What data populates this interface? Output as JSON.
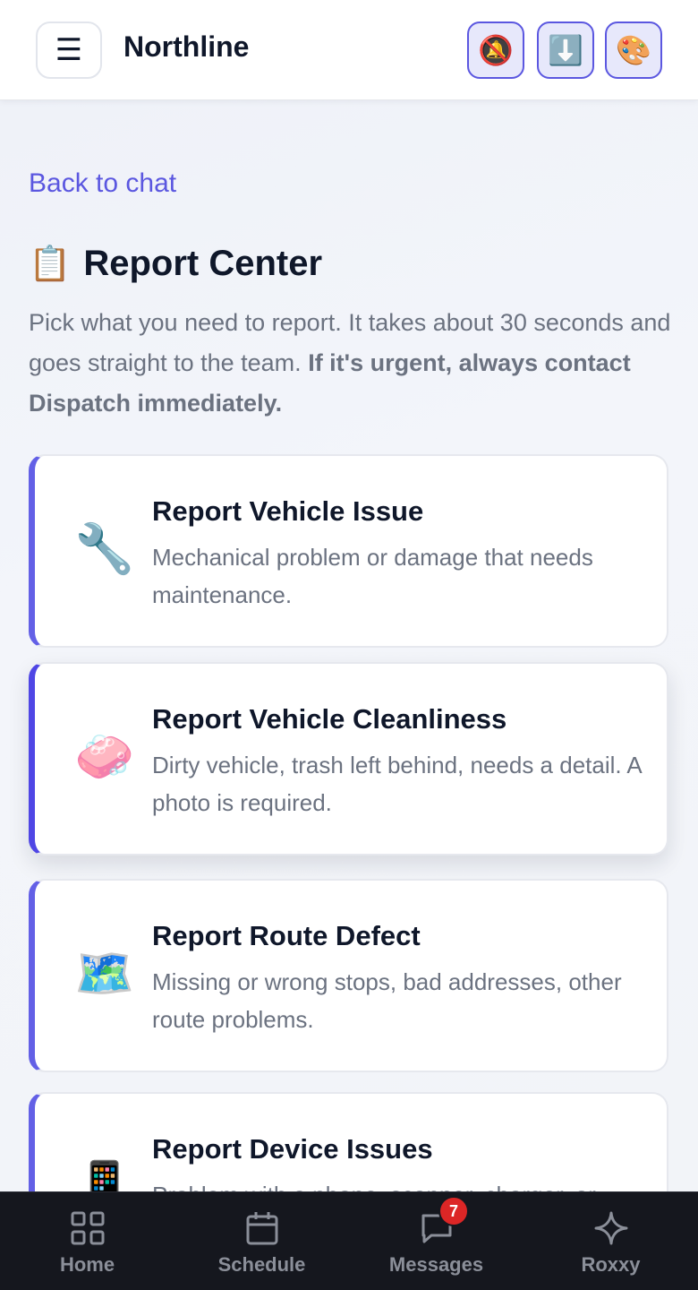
{
  "header": {
    "menu_glyph": "☰",
    "brand": "Northline",
    "actions": [
      {
        "icon": "bell-muted-icon",
        "glyph": "🔕"
      },
      {
        "icon": "download-icon",
        "glyph": "⬇️"
      },
      {
        "icon": "palette-icon",
        "glyph": "🎨"
      }
    ]
  },
  "back_link": "Back to chat",
  "title": {
    "glyph": "📋",
    "text": "Report Center"
  },
  "intro": {
    "plain": "Pick what you need to report. It takes about 30 seconds and goes straight to the team. ",
    "bold": "If it's urgent, always contact Dispatch immediately."
  },
  "cards": [
    {
      "icon": "wrench-icon",
      "glyph": "🔧",
      "title": "Report Vehicle Issue",
      "description": "Mechanical problem or damage that needs maintenance."
    },
    {
      "icon": "soap-icon",
      "glyph": "🧼",
      "title": "Report Vehicle Cleanliness",
      "description": "Dirty vehicle, trash left behind, needs a detail. A photo is required."
    },
    {
      "icon": "map-icon",
      "glyph": "🗺️",
      "title": "Report Route Defect",
      "description": "Missing or wrong stops, bad addresses, other route problems."
    },
    {
      "icon": "phone-icon",
      "glyph": "📱",
      "title": "Report Device Issues",
      "description": "Problem with a phone, scanner, charger, or"
    }
  ],
  "nav": [
    {
      "label": "Home",
      "icon": "grid-icon"
    },
    {
      "label": "Schedule",
      "icon": "calendar-icon"
    },
    {
      "label": "Messages",
      "icon": "chat-bubble-icon",
      "badge": "7"
    },
    {
      "label": "Roxxy",
      "icon": "sparkle-icon"
    }
  ],
  "colors": {
    "accent": "#5b57e0",
    "badge": "#dc2626",
    "nav_bg": "#15171e"
  }
}
